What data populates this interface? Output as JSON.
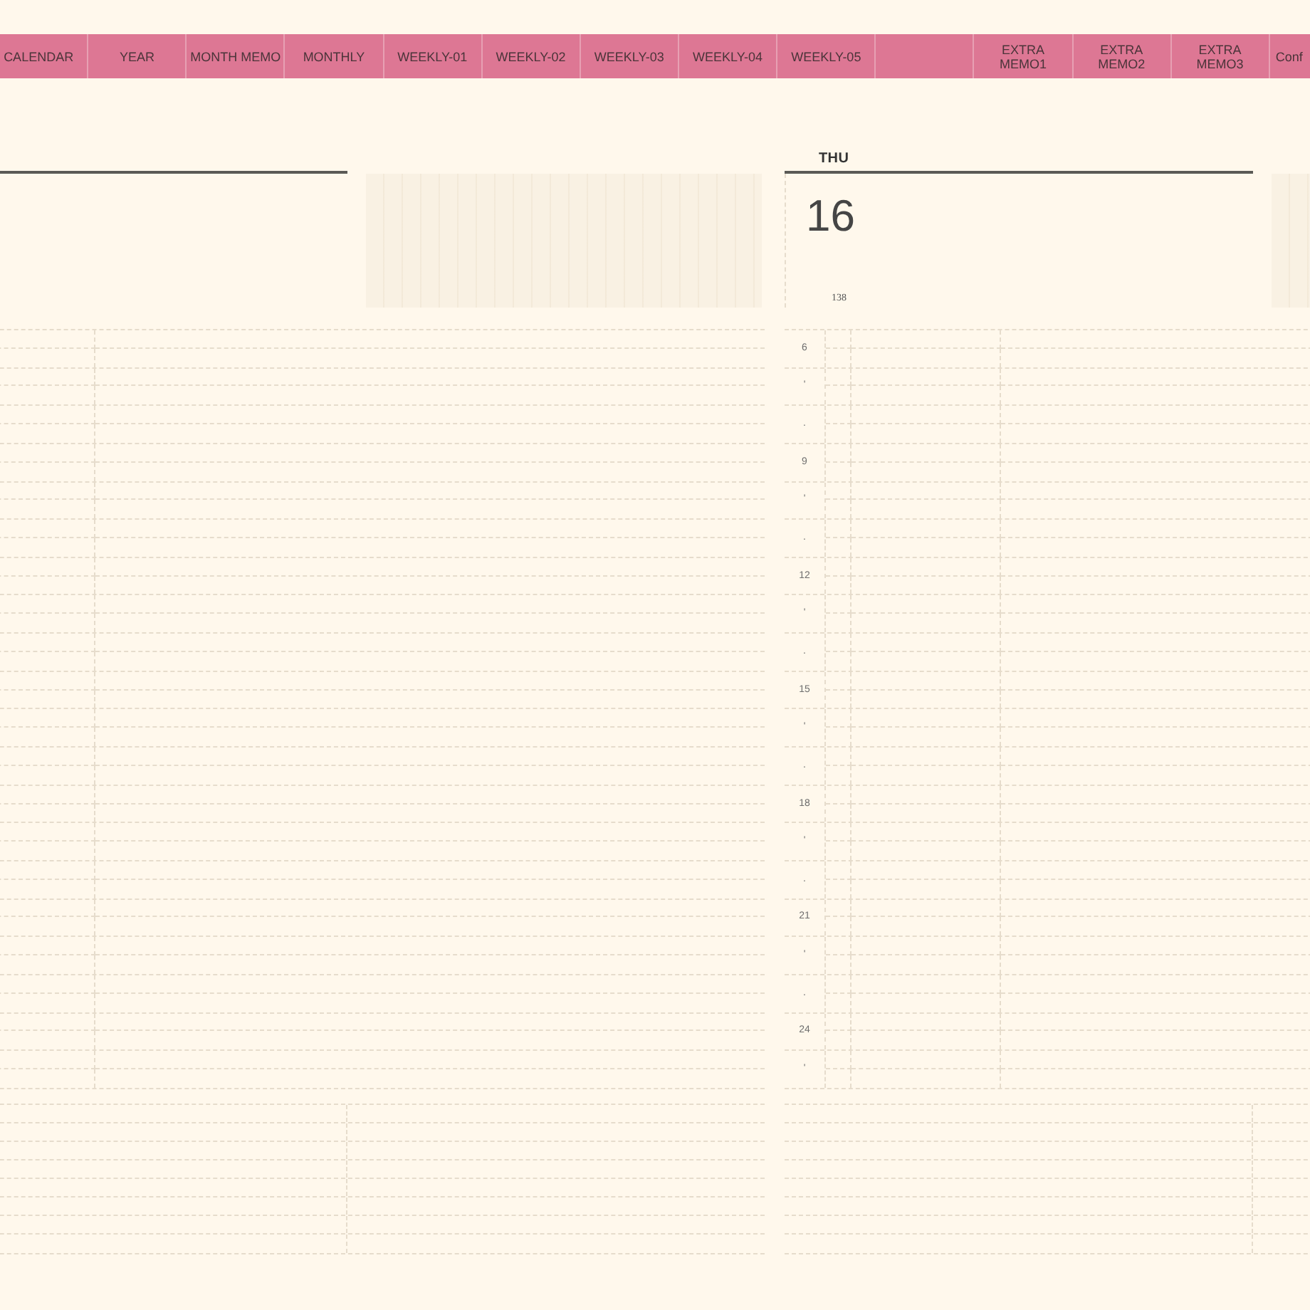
{
  "nav_tabs": [
    {
      "kind": "tab",
      "label": "CALENDAR"
    },
    {
      "kind": "tab",
      "label": "YEAR"
    },
    {
      "kind": "tab",
      "label": "MONTH MEMO"
    },
    {
      "kind": "tab",
      "label": "MONTHLY"
    },
    {
      "kind": "tab",
      "label": "WEEKLY-01"
    },
    {
      "kind": "tab",
      "label": "WEEKLY-02"
    },
    {
      "kind": "tab",
      "label": "WEEKLY-03"
    },
    {
      "kind": "tab",
      "label": "WEEKLY-04"
    },
    {
      "kind": "tab",
      "label": "WEEKLY-05"
    },
    {
      "kind": "spacer"
    },
    {
      "kind": "tab",
      "label": "EXTRA\nMEMO1"
    },
    {
      "kind": "tab",
      "label": "EXTRA\nMEMO2"
    },
    {
      "kind": "tab",
      "label": "EXTRA\nMEMO3"
    },
    {
      "kind": "tab",
      "label": "Conf"
    }
  ],
  "day": {
    "weekday": "THU",
    "date": "16",
    "day_of_year": "138",
    "hours": [
      "6",
      "'",
      ".",
      "9",
      "'",
      ".",
      "12",
      "'",
      ".",
      "15",
      "'",
      ".",
      "18",
      "'",
      ".",
      "21",
      "'",
      ".",
      "24",
      "'"
    ]
  }
}
